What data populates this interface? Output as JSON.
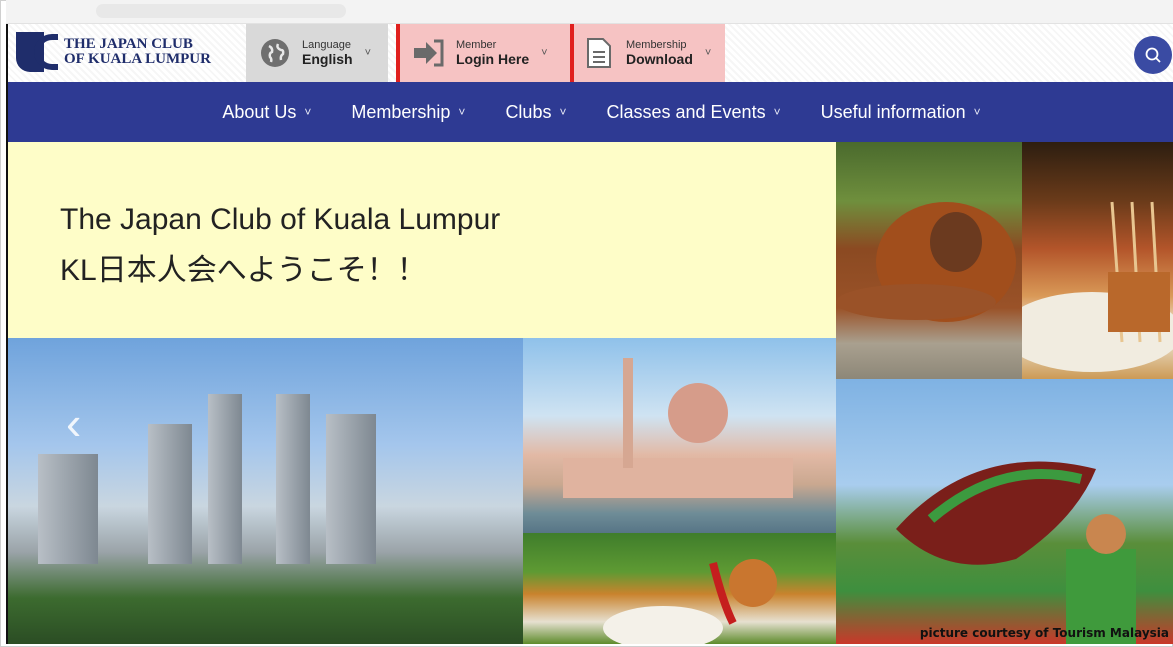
{
  "logo": {
    "line1": "THE JAPAN CLUB",
    "line2": "OF KUALA LUMPUR"
  },
  "header": {
    "language": {
      "small": "Language",
      "big": "English",
      "icon": "globe-icon"
    },
    "member": {
      "small": "Member",
      "big": "Login Here",
      "icon": "login-arrow-icon"
    },
    "membership": {
      "small": "Membership",
      "big": "Download",
      "icon": "document-icon"
    },
    "chevron": "˅",
    "search_icon": "search-icon",
    "highlight_color": "#e0201e"
  },
  "nav": {
    "items": [
      {
        "label": "About Us"
      },
      {
        "label": "Membership"
      },
      {
        "label": "Clubs"
      },
      {
        "label": "Classes and Events"
      },
      {
        "label": "Useful information"
      }
    ],
    "chevron": "˅",
    "background": "#2e3a93"
  },
  "hero": {
    "title": "The Japan Club of Kuala Lumpur",
    "subtitle": "KL日本人会へようこそ！！",
    "prev": "‹"
  },
  "photos": {
    "caption": "picture courtesy of Tourism Malaysia"
  }
}
